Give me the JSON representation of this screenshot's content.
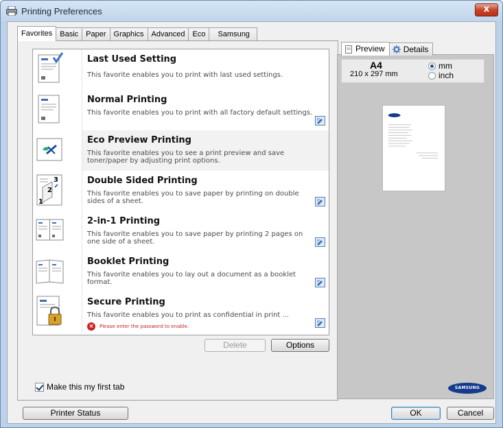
{
  "window": {
    "title": "Printing Preferences",
    "close_glyph": "x"
  },
  "tabs": [
    {
      "label": "Favorites"
    },
    {
      "label": "Basic"
    },
    {
      "label": "Paper"
    },
    {
      "label": "Graphics"
    },
    {
      "label": "Advanced"
    },
    {
      "label": "Eco"
    },
    {
      "label": "Samsung"
    }
  ],
  "favorites": [
    {
      "title": "Last Used Setting",
      "desc": "This favorite enables you to print with last used settings.",
      "icon": "last-used-document-icon"
    },
    {
      "title": "Normal Printing",
      "desc": "This favorite enables you to print with all factory default settings.",
      "icon": "normal-document-icon"
    },
    {
      "title": "Eco Preview Printing",
      "desc": "This favorite enables you to see a print preview and save toner/paper by adjusting print options.",
      "icon": "eco-leaf-icon"
    },
    {
      "title": "Double Sided Printing",
      "desc": "This favorite enables you to save paper by printing on double sides of a sheet.",
      "icon": "duplex-pages-icon"
    },
    {
      "title": "2-in-1 Printing",
      "desc": "This favorite enables you to save paper by printing 2 pages on one side of a sheet.",
      "icon": "two-in-one-pages-icon"
    },
    {
      "title": "Booklet Printing",
      "desc": "This favorite enables you to lay out a document as a booklet format.",
      "icon": "booklet-icon"
    },
    {
      "title": "Secure Printing",
      "desc": "This favorite enables you to print as confidential in print ...",
      "icon": "secure-lock-icon",
      "error": "Please enter the password to enable."
    }
  ],
  "buttons": {
    "delete": "Delete",
    "options": "Options",
    "printer_status": "Printer Status",
    "ok": "OK",
    "cancel": "Cancel"
  },
  "first_tab": {
    "label": "Make this my first tab",
    "checked": true
  },
  "preview": {
    "tabs": [
      {
        "label": "Preview"
      },
      {
        "label": "Details"
      }
    ],
    "paper_name": "A4",
    "paper_dims": "210 x 297 mm",
    "units": [
      {
        "label": "mm",
        "selected": true
      },
      {
        "label": "inch",
        "selected": false
      }
    ],
    "brand": "SAMSUNG"
  },
  "colors": {
    "titlebar": "#bfd5ec",
    "close_button": "#c7452b",
    "preview_bg": "#c7c7c7",
    "error": "#c42020",
    "brand": "#153b8c"
  }
}
